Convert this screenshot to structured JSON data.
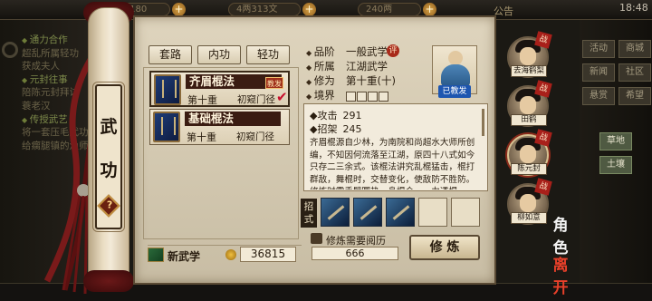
{
  "top_bar": {
    "energy": "51/180",
    "money": "4两313文",
    "gold": "240两",
    "notice": "公告",
    "time": "18:48"
  },
  "background_tasks": [
    {
      "text": "通力合作",
      "head": true
    },
    {
      "text": "超乱所属轻功",
      "head": false
    },
    {
      "text": "获成夫人",
      "head": false
    },
    {
      "text": "元封往事",
      "head": true
    },
    {
      "text": "陪陈元封拜访",
      "head": false
    },
    {
      "text": "蓑老汉",
      "head": false
    },
    {
      "text": "传授武艺",
      "head": true
    },
    {
      "text": "将一套压毛武功",
      "head": false
    },
    {
      "text": "给瘸腿镇的渔师",
      "head": false
    }
  ],
  "scroll": {
    "title_chars": [
      "武",
      "功"
    ],
    "help": "?"
  },
  "tabs": [
    "套路",
    "内功",
    "轻功"
  ],
  "skills": [
    {
      "name": "齐眉棍法",
      "level": "第十重",
      "rank": "初窥门径",
      "badge": "教发",
      "selected": true
    },
    {
      "name": "基础棍法",
      "level": "第十重",
      "rank": "初窥门径",
      "badge": "",
      "selected": false
    }
  ],
  "new_martial": {
    "label": "新武学",
    "currency_value": "36815"
  },
  "detail": {
    "grade_label": "品阶",
    "grade_value": "一般武学",
    "grade_tag": "评",
    "school_label": "所属",
    "school_value": "江湖武学",
    "cultivation_label": "修为",
    "cultivation_value": "第十重(十)",
    "realm_label": "境界",
    "taught_tag": "已教发",
    "attack_label": "攻击",
    "attack_value": "291",
    "parry_label": "招架",
    "parry_value": "245",
    "description": "齐眉棍源自少林，为南院和尚超水大师所创编，不知因何流落至江湖，原四十八式如今只存二三余式。该棍法讲究乱棍猛击，棍打群敌，舞棍时，交替变化，使敌防不胜防。修炼时需手臂圆热，身棍合一，力透棍",
    "moves_label": "招式",
    "moves_slots": 5,
    "moves_filled": 3,
    "requirement_label": "修炼需要阅历",
    "requirement_value": "666",
    "practice_button": "修 炼"
  },
  "characters": [
    {
      "name": "去海鹤梨",
      "tag": "战",
      "selected": false
    },
    {
      "name": "田鹤",
      "tag": "战",
      "selected": false
    },
    {
      "name": "陈元封",
      "tag": "战",
      "selected": true
    },
    {
      "name": "柳如意",
      "tag": "战",
      "selected": false
    }
  ],
  "right_menu": [
    "活动",
    "商城",
    "新闻",
    "社区",
    "悬赏",
    "希望",
    "草地",
    "土壤"
  ],
  "side_actions": {
    "role": "角色",
    "leave": "离开"
  }
}
